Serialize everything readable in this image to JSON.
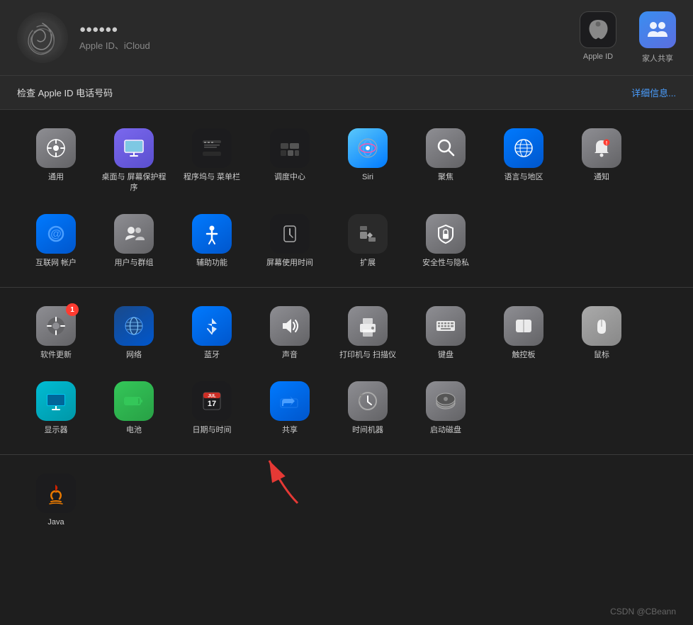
{
  "top": {
    "user_name": "●●●●●●",
    "user_subtitle": "Apple ID、iCloud",
    "apple_id_label": "Apple ID",
    "family_label": "家人共享"
  },
  "banner": {
    "text": "检查 Apple ID 电话号码",
    "link": "详细信息..."
  },
  "section1": {
    "items": [
      {
        "id": "general",
        "label": "通用",
        "bg": "bg-gray",
        "icon": "⚙"
      },
      {
        "id": "desktop-screen",
        "label": "桌面与\n屏幕保护程序",
        "bg": "bg-purple",
        "icon": "🖥"
      },
      {
        "id": "dock-menu",
        "label": "程序坞与\n菜单栏",
        "bg": "bg-dark",
        "icon": "⬛"
      },
      {
        "id": "mission-control",
        "label": "调度中心",
        "bg": "bg-dark",
        "icon": "⊞"
      },
      {
        "id": "siri",
        "label": "Siri",
        "bg": "bg-light-blue",
        "icon": "◎"
      },
      {
        "id": "spotlight",
        "label": "聚焦",
        "bg": "bg-gray",
        "icon": "🔍"
      },
      {
        "id": "language-region",
        "label": "语言与地区",
        "bg": "bg-blue",
        "icon": "🌐"
      },
      {
        "id": "notifications",
        "label": "通知",
        "bg": "bg-gray",
        "icon": "🔔"
      },
      {
        "id": "internet-accounts",
        "label": "互联网\n帐户",
        "bg": "bg-blue",
        "icon": "@"
      },
      {
        "id": "users-groups",
        "label": "用户与群组",
        "bg": "bg-gray",
        "icon": "👥"
      },
      {
        "id": "accessibility",
        "label": "辅助功能",
        "bg": "bg-blue",
        "icon": "♿"
      },
      {
        "id": "screen-time",
        "label": "屏幕使用时间",
        "bg": "bg-dark",
        "icon": "⏳"
      },
      {
        "id": "extensions",
        "label": "扩展",
        "bg": "bg-dark",
        "icon": "🧩"
      },
      {
        "id": "security-privacy",
        "label": "安全性与隐私",
        "bg": "bg-gray",
        "icon": "🏠"
      }
    ]
  },
  "section2": {
    "items": [
      {
        "id": "software-update",
        "label": "软件更新",
        "bg": "bg-gray",
        "icon": "⚙",
        "badge": "1"
      },
      {
        "id": "network",
        "label": "网络",
        "bg": "bg-blue",
        "icon": "🌐"
      },
      {
        "id": "bluetooth",
        "label": "蓝牙",
        "bg": "bg-blue",
        "icon": "₿"
      },
      {
        "id": "sound",
        "label": "声音",
        "bg": "bg-gray",
        "icon": "🔊"
      },
      {
        "id": "printers-scanners",
        "label": "打印机与\n扫描仪",
        "bg": "bg-gray",
        "icon": "🖨"
      },
      {
        "id": "keyboard",
        "label": "键盘",
        "bg": "bg-gray",
        "icon": "⌨"
      },
      {
        "id": "trackpad",
        "label": "触控板",
        "bg": "bg-gray",
        "icon": "▭"
      },
      {
        "id": "mouse",
        "label": "鼠标",
        "bg": "bg-gray",
        "icon": "🖱"
      },
      {
        "id": "displays",
        "label": "显示器",
        "bg": "bg-cyan",
        "icon": "🖥"
      },
      {
        "id": "battery",
        "label": "电池",
        "bg": "bg-green",
        "icon": "🔋"
      },
      {
        "id": "date-time",
        "label": "日期与时间",
        "bg": "bg-dark",
        "icon": "📅"
      },
      {
        "id": "sharing",
        "label": "共享",
        "bg": "bg-blue",
        "icon": "📁"
      },
      {
        "id": "time-machine",
        "label": "时间机器",
        "bg": "bg-gray",
        "icon": "⏱"
      },
      {
        "id": "startup-disk",
        "label": "启动磁盘",
        "bg": "bg-gray",
        "icon": "💿"
      }
    ]
  },
  "section3": {
    "items": [
      {
        "id": "java",
        "label": "Java",
        "bg": "bg-dark",
        "icon": "☕"
      }
    ]
  },
  "watermark": "CSDN @CBeann"
}
